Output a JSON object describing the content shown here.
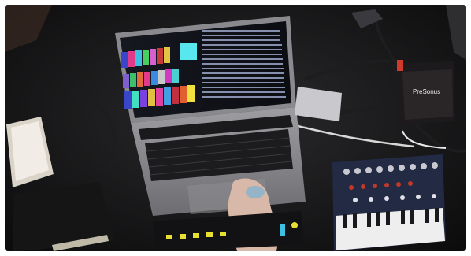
{
  "photo": {
    "description_hidden": "",
    "audio_interface_brand": "PreSonus"
  }
}
